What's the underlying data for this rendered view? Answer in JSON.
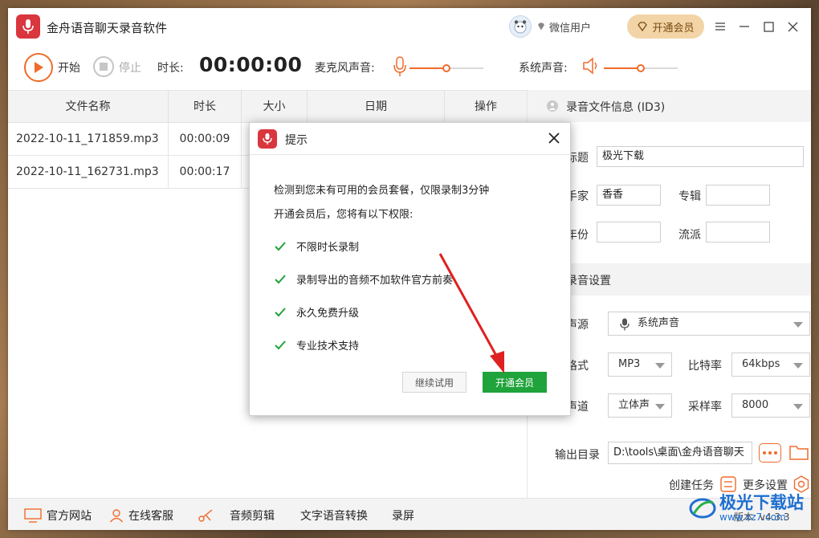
{
  "app": {
    "title": "金舟语音聊天录音软件",
    "user_name": "微信用户",
    "vip_label": "开通会员"
  },
  "toolbar": {
    "start_label": "开始",
    "stop_label": "停止",
    "duration_label": "时长:",
    "duration_value": "00:00:00",
    "mic_label": "麦克风声音:",
    "mic_level": 0.5,
    "sys_label": "系统声音:",
    "sys_level": 0.5
  },
  "table": {
    "headers": [
      "文件名称",
      "时长",
      "大小",
      "日期",
      "操作"
    ],
    "rows": [
      {
        "name": "2022-10-11_171859.mp3",
        "duration": "00:00:09"
      },
      {
        "name": "2022-10-11_162731.mp3",
        "duration": "00:00:17"
      }
    ]
  },
  "id3": {
    "section_title": "录音文件信息 (ID3)",
    "title_label": "标题",
    "title_value": "极光下载",
    "artist_label": "歌手家",
    "artist_value": "香香",
    "album_label": "专辑",
    "album_value": "",
    "year_label": "年份",
    "year_value": "",
    "genre_label": "流派",
    "genre_value": ""
  },
  "settings": {
    "section_title": "录音设置",
    "source_label": "声源",
    "source_value": "系统声音",
    "format_label": "格式",
    "format_value": "MP3",
    "bitrate_label": "比特率",
    "bitrate_value": "64kbps",
    "channel_label": "声道",
    "channel_value": "立体声",
    "samplerate_label": "采样率",
    "samplerate_value": "8000",
    "output_label": "输出目录",
    "output_value": "D:\\tools\\桌面\\金舟语音聊天",
    "create_task_label": "创建任务",
    "more_settings_label": "更多设置"
  },
  "bottombar": {
    "website": "官方网站",
    "service": "在线客服",
    "audio_edit": "音频剪辑",
    "tts": "文字语音转换",
    "screen_rec": "录屏",
    "version": "版本: v4.3.3"
  },
  "dialog": {
    "title": "提示",
    "line1": "检测到您未有可用的会员套餐，仅限录制3分钟",
    "line2": "开通会员后，您将有以下权限:",
    "perks": [
      "不限时长录制",
      "录制导出的音频不加软件官方前奏",
      "永久免费升级",
      "专业技术支持"
    ],
    "trial_label": "继续试用",
    "vip_label": "开通会员"
  },
  "watermark": {
    "text": "极光下载站",
    "url": "www.xz7.com"
  },
  "colors": {
    "accent": "#f06b2a",
    "brand": "#d9363e",
    "green": "#1fa33a",
    "vip_bg": "#f2d4a6"
  }
}
